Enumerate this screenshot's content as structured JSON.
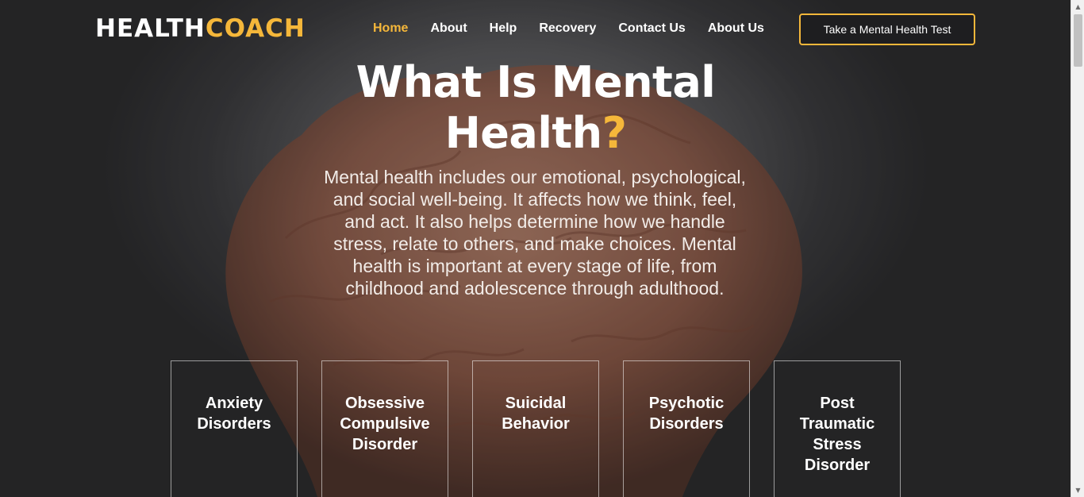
{
  "brand": {
    "name_main": "HEALTH",
    "name_accent": "COACH"
  },
  "nav": {
    "items": [
      {
        "label": "Home",
        "active": true
      },
      {
        "label": "About",
        "active": false
      },
      {
        "label": "Help",
        "active": false
      },
      {
        "label": "Recovery",
        "active": false
      },
      {
        "label": "Contact Us",
        "active": false
      },
      {
        "label": "About Us",
        "active": false
      }
    ],
    "cta_label": "Take a Mental Health Test"
  },
  "hero": {
    "title_line1": "What Is Mental",
    "title_line2": "Health",
    "title_mark": "?",
    "description": "Mental health includes our emotional, psychological, and social well-being. It affects how we think, feel, and act. It also helps determine how we handle stress, relate to others, and make choices. Mental health is important at every stage of life, from childhood and adolescence through adulthood."
  },
  "cards": [
    {
      "title": "Anxiety Disorders"
    },
    {
      "title": "Obsessive Compulsive Disorder"
    },
    {
      "title": "Suicidal Behavior"
    },
    {
      "title": "Psychotic Disorders"
    },
    {
      "title": "Post Traumatic Stress Disorder"
    }
  ],
  "colors": {
    "accent": "#f5b73a",
    "text": "#ffffff",
    "background": "#2b2b2d"
  },
  "icons": {
    "scroll_up": "triangle-up-icon",
    "scroll_down": "triangle-down-icon"
  }
}
